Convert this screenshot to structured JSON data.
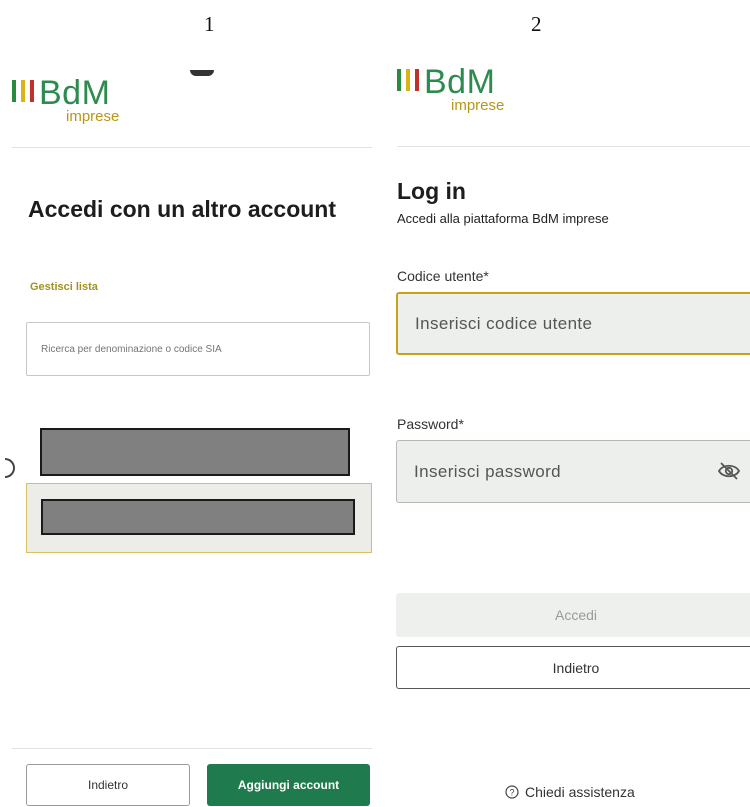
{
  "labels": {
    "left": "1",
    "right": "2"
  },
  "brand": {
    "name": "BdM",
    "tagline": "imprese"
  },
  "colors": {
    "brand_green": "#2e8b4f",
    "brand_gold": "#b79618",
    "focus_gold": "#c6a21e",
    "primary_green": "#1f7a4d",
    "bar_green": "#2a8a3e",
    "bar_gold": "#d8b417",
    "bar_red": "#c0312b"
  },
  "left_screen": {
    "title": "Accedi con un altro account",
    "manage_link": "Gestisci lista",
    "search": {
      "placeholder": "Ricerca per denominazione o codice SIA"
    },
    "accounts": [
      {
        "name": "",
        "selected": false
      },
      {
        "name": "",
        "selected": true
      }
    ],
    "buttons": {
      "back": "Indietro",
      "add": "Aggiungi account"
    }
  },
  "right_screen": {
    "title": "Log in",
    "subtitle": "Accedi alla piattaforma BdM imprese",
    "user_field": {
      "label": "Codice utente*",
      "placeholder": "Inserisci codice utente"
    },
    "password_field": {
      "label": "Password*",
      "placeholder": "Inserisci password",
      "toggle_icon": "eye-off-icon"
    },
    "buttons": {
      "login": "Accedi",
      "back": "Indietro"
    },
    "help": {
      "label": "Chiedi assistenza",
      "icon": "question-circle-icon"
    }
  }
}
